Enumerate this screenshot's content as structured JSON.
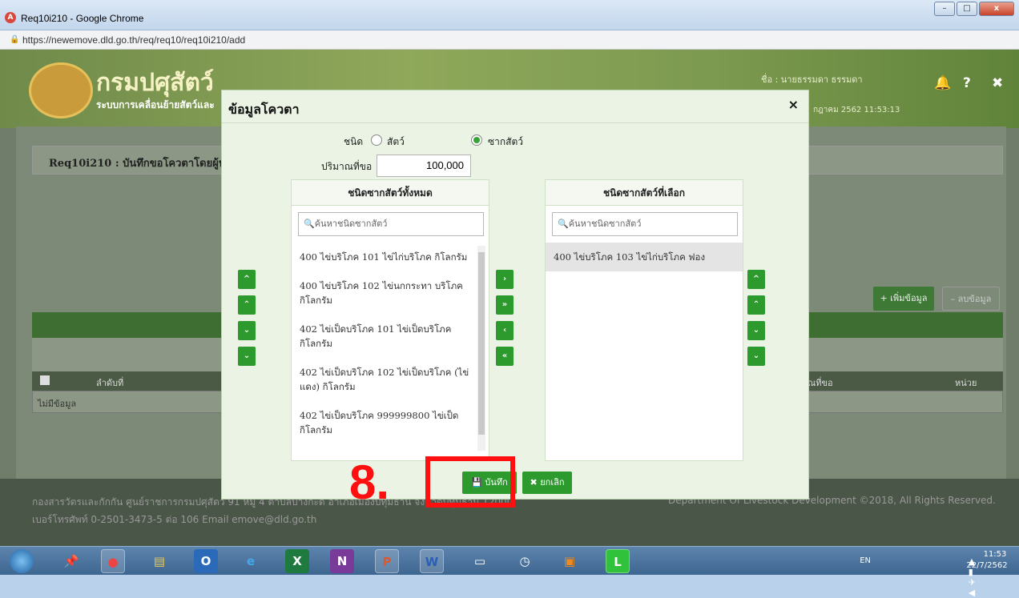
{
  "window": {
    "title": "Req10i210 - Google Chrome",
    "url": "https://newemove.dld.go.th/req/req10/req10i210/add",
    "btn_min": "–",
    "btn_max": "□",
    "btn_close": "x"
  },
  "header": {
    "brand": "กรมปศุสัตว์",
    "subtitle": "ระบบการเคลื่อนย้ายสัตว์และ",
    "user": "ชื่อ : นายธรรมดา ธรรมดา",
    "date": "กฎาคม 2562 11:53:13"
  },
  "page": {
    "breadcrumb": "Req10i210 : บันทึกขอโควตาโดยผู้ประก",
    "add_label": "+ เพิ่มข้อมูล",
    "delete_label": "– ลบข้อมูล",
    "col_no": "ลำดับที่",
    "col_qty": "ณที่ขอ",
    "col_unit": "หน่วย",
    "no_data": "ไม่มีข้อมูล"
  },
  "footer": {
    "line1": "กองสารวัตรและกักกัน ศูนย์ราชการกรมปศุสัตว์ 91 หมู่ 4 ตำบลบางกะดี อำเภอเมืองปทุมธานี จังหวัดปทุมธานี 12000",
    "line2": "เบอร์โทรศัพท์ 0-2501-3473-5 ต่อ 106 Email emove@dld.go.th",
    "copyright": "Department Of Livestock Development ©2018, All Rights Reserved."
  },
  "modal": {
    "title": "ข้อมูลโควตา",
    "type_label": "ชนิด",
    "opt_animal": "สัตว์",
    "opt_carcass": "ซากสัตว์",
    "selected_type": "ซากสัตว์",
    "qty_label": "ปริมาณที่ขอ",
    "qty_value": "100,000",
    "left_title": "ชนิดซากสัตว์ทั้งหมด",
    "right_title": "ชนิดซากสัตว์ที่เลือก",
    "search_placeholder": "ค้นหาชนิดซากสัตว์",
    "left_items": [
      "400 ไข่บริโภค 101 ไข่ไก่บริโภค กิโลกรัม",
      "400 ไข่บริโภค 102 ไข่นกกระทา บริโภค กิโลกรัม",
      "402 ไข่เป็ดบริโภค 101 ไข่เป็ดบริโภค กิโลกรัม",
      "402 ไข่เป็ดบริโภค 102 ไข่เป็ดบริโภค (ไข่แดง) กิโลกรัม",
      "402 ไข่เป็ดบริโภค 999999800 ไข่เป็ด กิโลกรัม"
    ],
    "right_items": [
      "400 ไข่บริโภค 103 ไข่ไก่บริโภค ฟอง"
    ],
    "save_label": "บันทึก",
    "cancel_label": "ยกเลิก",
    "close": "×",
    "arrows": {
      "up": "^",
      "top": "⌃",
      "down": "⌄",
      "bottom": "⌄",
      "right": "›",
      "right_all": "»",
      "left": "‹",
      "left_all": "«"
    }
  },
  "annotation": {
    "step": "8."
  },
  "taskbar": {
    "lang": "EN",
    "time": "11:53",
    "date": "22/7/2562"
  }
}
